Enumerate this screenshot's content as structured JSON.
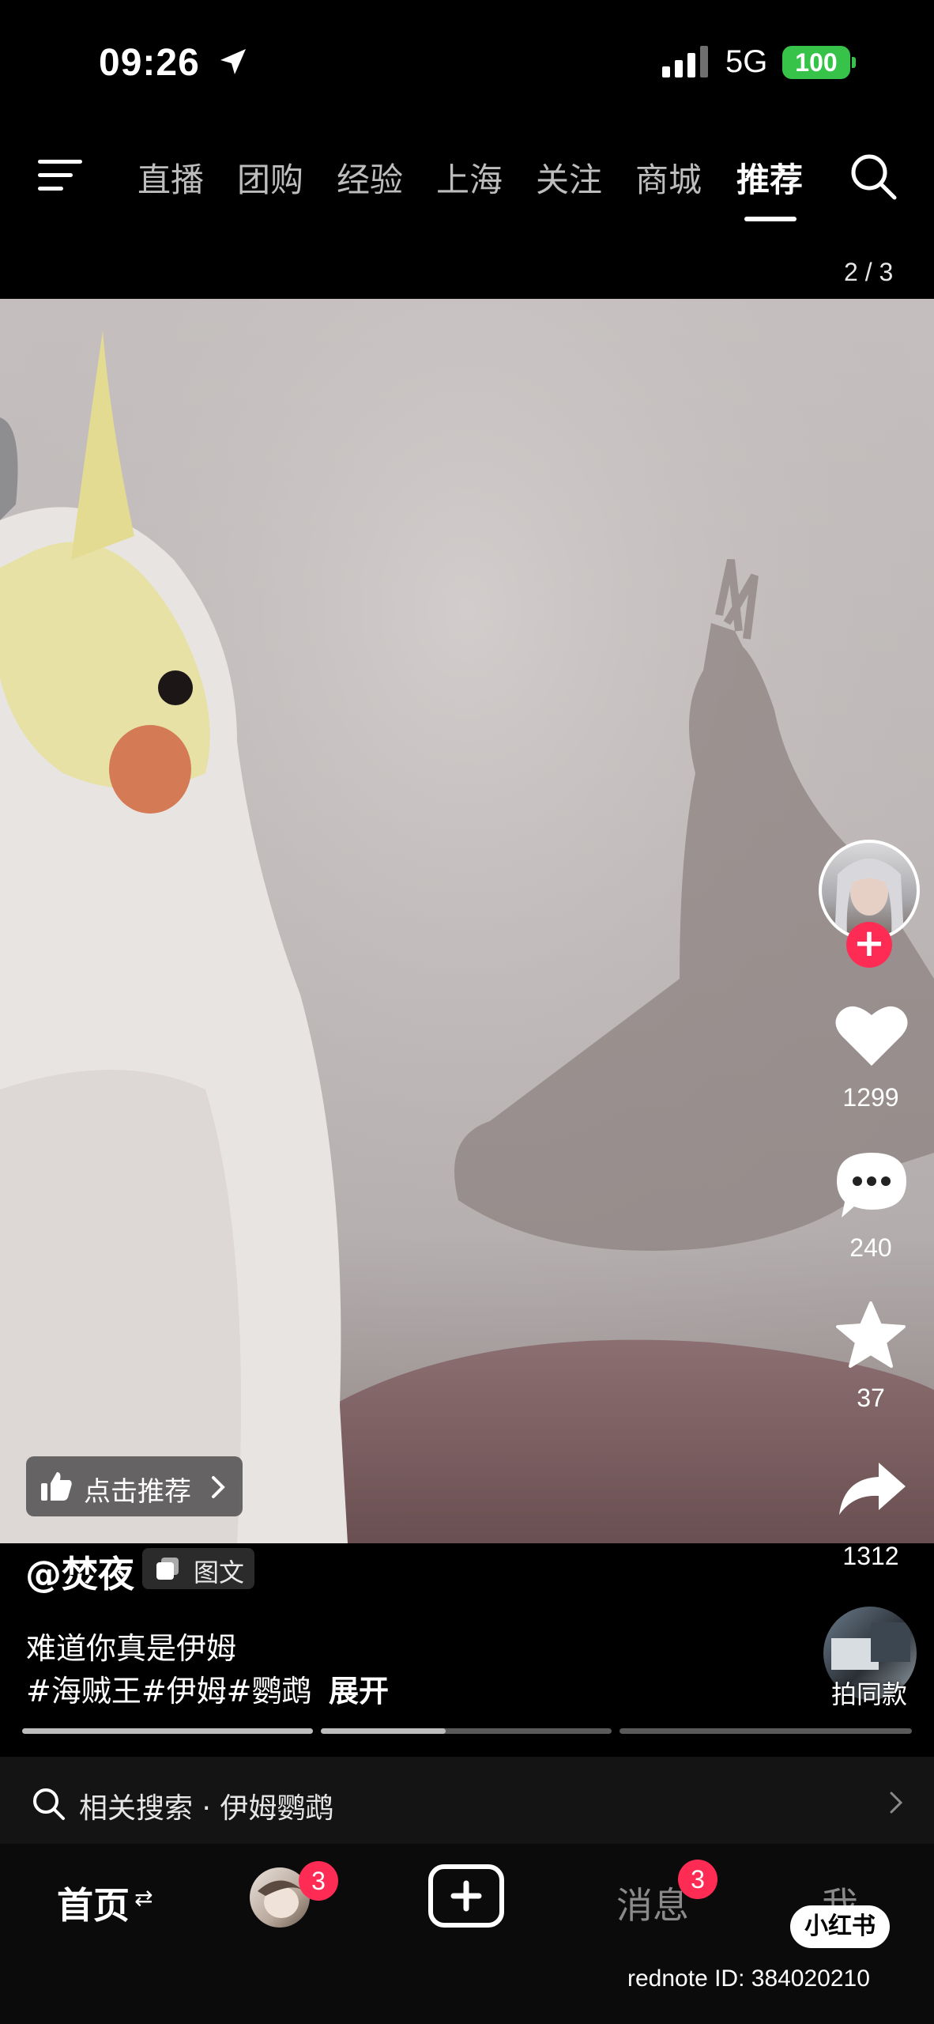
{
  "status_bar": {
    "time": "09:26",
    "network": "5G",
    "battery": "100"
  },
  "top_nav": {
    "tabs": [
      "直播",
      "团购",
      "经验",
      "上海",
      "关注",
      "商城",
      "推荐"
    ],
    "active_tab": "推荐"
  },
  "page_indicator": "2 / 3",
  "recommend_chip": "点击推荐",
  "right_rail": {
    "likes": "1299",
    "comments": "240",
    "favorites": "37",
    "shares": "1312"
  },
  "post": {
    "author": "@焚夜",
    "type_label": "图文",
    "description": "难道你真是伊姆",
    "hashtags": "#海贼王#伊姆#鹦鹉",
    "expand_label": "展开",
    "same_style_label": "拍同款",
    "image_progress": [
      1.0,
      0.43,
      0.0
    ]
  },
  "related_search": {
    "label": "相关搜索 · 伊姆鹦鹉"
  },
  "bottom_nav": {
    "home": "首页",
    "friends_badge": "3",
    "messages": "消息",
    "messages_badge": "3",
    "me": "我"
  },
  "watermark": {
    "logo": "小红书",
    "id": "rednote ID: 384020210"
  },
  "colors": {
    "accent": "#fe2c55",
    "battery": "#37c24a"
  }
}
